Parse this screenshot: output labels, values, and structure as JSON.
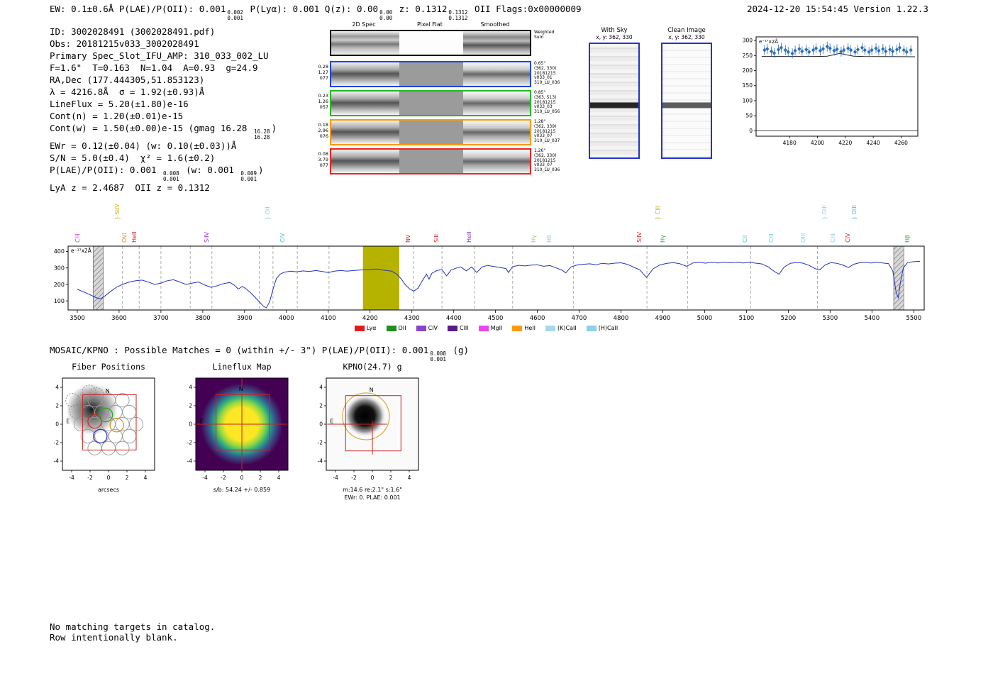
{
  "header": {
    "left_segments": [
      {
        "t": "EW: 0.1±0.6Å  P(LAE)/P(OII): 0.001"
      },
      {
        "s": [
          "0.002",
          "0.001"
        ]
      },
      {
        "t": " P(Lyα): 0.001  Q(z): 0.00"
      },
      {
        "s": [
          "0.00",
          "0.00"
        ]
      },
      {
        "t": " z: 0.1312"
      },
      {
        "s": [
          "0.1312",
          "0.1312"
        ]
      },
      {
        "t": " OII   Flags:0x00000009"
      }
    ],
    "right": "2024-12-20 15:54:45  Version 1.22.3"
  },
  "info_lines": [
    [
      {
        "t": "ID: 3002028491 (3002028491.pdf)"
      }
    ],
    [
      {
        "t": "Obs: 20181215v033_3002028491"
      }
    ],
    [
      {
        "t": "Primary Spec_Slot_IFU_AMP: 310_033_002_LU"
      }
    ],
    [
      {
        "t": "F=1.6\"  T=0.163  N=1.04  A=0.93  g=24.9"
      }
    ],
    [
      {
        "t": "RA,Dec (177.444305,51.853123)"
      }
    ],
    [
      {
        "t": "λ = 4216.8Å  σ = 1.92(±0.93)Å"
      }
    ],
    [
      {
        "t": "LineFlux = 5.20(±1.80)e-16"
      }
    ],
    [
      {
        "t": "Cont(n) = 1.20(±0.01)e-15"
      }
    ],
    [
      {
        "t": "Cont(w) = 1.50(±0.00)e-15 (gmag 16.28 "
      },
      {
        "s": [
          "16.28",
          "16.28"
        ]
      },
      {
        "t": ")"
      }
    ],
    [
      {
        "t": "EWr = 0.12(±0.04) (w: 0.10(±0.03))Å"
      }
    ],
    [
      {
        "t": "S/N = 5.0(±0.4)  χ² = 1.6(±0.2)"
      }
    ],
    [
      {
        "t": "P(LAE)/P(OII): 0.001 "
      },
      {
        "s": [
          "0.008",
          "0.001"
        ]
      },
      {
        "t": " (w: 0.001 "
      },
      {
        "s": [
          "0.009",
          "0.001"
        ]
      },
      {
        "t": ")"
      }
    ],
    [
      {
        "t": "LyA z = 2.4687  OII z = 0.1312"
      }
    ]
  ],
  "cutouts": {
    "col_headers": [
      "2D Spec",
      "Pixel Flat",
      "Smoothed"
    ],
    "sum_label_lines": [
      "Weighted",
      "Sum"
    ],
    "rows": [
      {
        "left": [
          "0.28",
          "1.27",
          "077"
        ],
        "right": [
          "0.65\"",
          "(362, 330)",
          "20181215",
          "v033_01",
          "310_LU_036"
        ],
        "border": "#2244dd"
      },
      {
        "left": [
          "0.23",
          "1.26",
          "057"
        ],
        "right": [
          "0.85\"",
          "(363, 513)",
          "20181215",
          "v033_03",
          "310_LU_056"
        ],
        "border": "#22bb22"
      },
      {
        "left": [
          "0.18",
          "2.96",
          "076"
        ],
        "right": [
          "1.28\"",
          "(362, 339)",
          "20181215",
          "v033_07",
          "310_LU_037"
        ],
        "border": "#ff9900"
      },
      {
        "left": [
          "0.08",
          "3.79",
          "077"
        ],
        "right": [
          "1.26\"",
          "(362, 330)",
          "20181215",
          "v033_07",
          "310_LU_036"
        ],
        "border": "#ee2222"
      }
    ]
  },
  "sky_panels": {
    "with_sky": {
      "title": "With Sky",
      "coords": "x, y: 362, 330"
    },
    "clean": {
      "title": "Clean Image",
      "coords": "x, y: 362, 330"
    }
  },
  "mosaic_segments": [
    {
      "t": "MOSAIC/KPNO : Possible Matches = 0 (within +/- 3\")  P(LAE)/P(OII): 0.001"
    },
    {
      "s": [
        "0.008",
        "0.001"
      ]
    },
    {
      "t": " (g)"
    }
  ],
  "matches_panels": {
    "fiber": {
      "title": "Fiber Positions",
      "xlabel": "arcsecs"
    },
    "lineflux": {
      "title": "Lineflux Map",
      "caption": "s/b: 54.24 +/- 0.859"
    },
    "kpno": {
      "title": "KPNO(24.7) g",
      "caption1": "m:14.6 re:2.1\" s:1.6\"",
      "caption2": "EWr: 0. PLAE: 0.001"
    },
    "ticks": [
      -4,
      -2,
      0,
      2,
      4
    ],
    "north_label": "N",
    "east_label": "E"
  },
  "footer_lines": [
    "No matching targets in catalog.",
    "Row intentionally blank."
  ],
  "chart_data": [
    {
      "type": "scatter",
      "note": "e⁻¹⁷x2Å",
      "xticks": [
        4180,
        4200,
        4220,
        4240,
        4260
      ],
      "yticks": [
        0,
        50,
        100,
        150,
        200,
        250,
        300
      ],
      "xlim": [
        4156,
        4272
      ],
      "ylim": [
        -18,
        312
      ],
      "point_color": "#2a6fba",
      "line_color": "#222222",
      "points": [
        [
          4162,
          268
        ],
        [
          4164,
          272
        ],
        [
          4167,
          264
        ],
        [
          4169,
          258
        ],
        [
          4172,
          270
        ],
        [
          4174,
          276
        ],
        [
          4177,
          268
        ],
        [
          4179,
          262
        ],
        [
          4182,
          257
        ],
        [
          4184,
          266
        ],
        [
          4187,
          272
        ],
        [
          4189,
          264
        ],
        [
          4192,
          270
        ],
        [
          4194,
          262
        ],
        [
          4197,
          268
        ],
        [
          4199,
          274
        ],
        [
          4202,
          266
        ],
        [
          4204,
          272
        ],
        [
          4207,
          280
        ],
        [
          4209,
          274
        ],
        [
          4212,
          266
        ],
        [
          4214,
          271
        ],
        [
          4217,
          263
        ],
        [
          4219,
          268
        ],
        [
          4222,
          274
        ],
        [
          4224,
          268
        ],
        [
          4227,
          262
        ],
        [
          4229,
          270
        ],
        [
          4232,
          276
        ],
        [
          4234,
          268
        ],
        [
          4237,
          262
        ],
        [
          4239,
          268
        ],
        [
          4242,
          274
        ],
        [
          4244,
          266
        ],
        [
          4247,
          272
        ],
        [
          4249,
          264
        ],
        [
          4252,
          270
        ],
        [
          4254,
          264
        ],
        [
          4257,
          270
        ],
        [
          4259,
          276
        ],
        [
          4262,
          268
        ],
        [
          4264,
          262
        ],
        [
          4267,
          268
        ]
      ],
      "fit_line": [
        [
          4160,
          247
        ],
        [
          4200,
          247
        ],
        [
          4207,
          248
        ],
        [
          4212,
          253
        ],
        [
          4216,
          257
        ],
        [
          4220,
          253
        ],
        [
          4226,
          248
        ],
        [
          4233,
          247
        ],
        [
          4270,
          246
        ]
      ]
    },
    {
      "type": "line",
      "note": "e⁻¹⁷x2Å",
      "xticks": [
        3500,
        3600,
        3700,
        3800,
        3900,
        4000,
        4100,
        4200,
        4300,
        4400,
        4500,
        4600,
        4700,
        4800,
        4900,
        5000,
        5100,
        5200,
        5300,
        5400,
        5500
      ],
      "yticks": [
        100,
        200,
        300,
        400
      ],
      "xlim": [
        3478,
        5525
      ],
      "ylim": [
        45,
        432
      ],
      "series_color": "#2233bb",
      "highlight_band": {
        "range": [
          4183,
          4270
        ],
        "color": "#b5b300"
      },
      "hatch_bands": [
        [
          3538,
          3562
        ],
        [
          5452,
          5476
        ]
      ],
      "dashed_lines": [
        3608,
        3648,
        3700,
        3770,
        3822,
        3935,
        3968,
        4026,
        4102,
        4304,
        4372,
        4450,
        4541,
        4686,
        4862,
        4959,
        5110,
        5270
      ],
      "line_labels": [
        {
          "text": "CIII",
          "wave": 3513,
          "color": "#cc44cc",
          "tall": false
        },
        {
          "text": "SiIV",
          "wave": 3608,
          "color": "#d4aa00",
          "tall": true
        },
        {
          "text": "OVI",
          "wave": 3626,
          "color": "#ee8822",
          "tall": false
        },
        {
          "text": "HeII",
          "wave": 3650,
          "color": "#cc2222",
          "tall": false
        },
        {
          "text": "SiIV",
          "wave": 3822,
          "color": "#8833cc",
          "tall": false
        },
        {
          "text": "OII",
          "wave": 3968,
          "color": "#77ccee",
          "tall": true
        },
        {
          "text": "CIV",
          "wave": 4004,
          "color": "#44bbcc",
          "tall": false
        },
        {
          "text": "NV",
          "wave": 4304,
          "color": "#cc2222",
          "tall": false
        },
        {
          "text": "SiII",
          "wave": 4372,
          "color": "#cc2222",
          "tall": false
        },
        {
          "text": "HeII",
          "wave": 4450,
          "color": "#8833cc",
          "tall": false
        },
        {
          "text": "Hγ",
          "wave": 4604,
          "color": "#99cc66",
          "tall": false
        },
        {
          "text": "Hδ",
          "wave": 4642,
          "color": "#88ccdd",
          "tall": false
        },
        {
          "text": "SiIV",
          "wave": 4856,
          "color": "#cc2222",
          "tall": false
        },
        {
          "text": "CIII",
          "wave": 4900,
          "color": "#d4aa00",
          "tall": true
        },
        {
          "text": "Hγ",
          "wave": 4912,
          "color": "#33aa33",
          "tall": false
        },
        {
          "text": "CII",
          "wave": 5110,
          "color": "#44bbcc",
          "tall": false
        },
        {
          "text": "CIII",
          "wave": 5172,
          "color": "#66ccee",
          "tall": false
        },
        {
          "text": "OIII",
          "wave": 5248,
          "color": "#88ccee",
          "tall": false
        },
        {
          "text": "OIII",
          "wave": 5300,
          "color": "#88ccee",
          "tall": true
        },
        {
          "text": "CIII",
          "wave": 5320,
          "color": "#88ccee",
          "tall": false
        },
        {
          "text": "CIV",
          "wave": 5356,
          "color": "#cc2222",
          "tall": false
        },
        {
          "text": "OIII",
          "wave": 5370,
          "color": "#44bbcc",
          "tall": true
        },
        {
          "text": "Hβ",
          "wave": 5497,
          "color": "#33aa33",
          "tall": false
        }
      ],
      "legend": [
        {
          "label": "Lyα",
          "color": "#e41a1c"
        },
        {
          "label": "OII",
          "color": "#1f8f1f"
        },
        {
          "label": "CIV",
          "color": "#8844cc"
        },
        {
          "label": "CIII",
          "color": "#5a1a8a"
        },
        {
          "label": "MgII",
          "color": "#ee44ee"
        },
        {
          "label": "HeII",
          "color": "#ff9911"
        },
        {
          "label": "(K)CaII",
          "color": "#a8d8ea"
        },
        {
          "label": "(H)CaII",
          "color": "#8fd0e8"
        }
      ],
      "points": [
        [
          3500,
          170
        ],
        [
          3515,
          155
        ],
        [
          3530,
          138
        ],
        [
          3545,
          120
        ],
        [
          3555,
          112
        ],
        [
          3565,
          128
        ],
        [
          3580,
          158
        ],
        [
          3595,
          185
        ],
        [
          3610,
          202
        ],
        [
          3625,
          215
        ],
        [
          3640,
          222
        ],
        [
          3655,
          226
        ],
        [
          3670,
          214
        ],
        [
          3685,
          200
        ],
        [
          3700,
          208
        ],
        [
          3715,
          222
        ],
        [
          3730,
          228
        ],
        [
          3745,
          215
        ],
        [
          3760,
          200
        ],
        [
          3775,
          208
        ],
        [
          3790,
          215
        ],
        [
          3805,
          196
        ],
        [
          3820,
          182
        ],
        [
          3835,
          192
        ],
        [
          3850,
          205
        ],
        [
          3865,
          212
        ],
        [
          3875,
          196
        ],
        [
          3885,
          172
        ],
        [
          3895,
          188
        ],
        [
          3905,
          170
        ],
        [
          3915,
          148
        ],
        [
          3925,
          122
        ],
        [
          3935,
          95
        ],
        [
          3945,
          68
        ],
        [
          3952,
          58
        ],
        [
          3960,
          95
        ],
        [
          3968,
          170
        ],
        [
          3976,
          235
        ],
        [
          3985,
          262
        ],
        [
          3995,
          274
        ],
        [
          4010,
          280
        ],
        [
          4025,
          276
        ],
        [
          4040,
          282
        ],
        [
          4055,
          278
        ],
        [
          4070,
          284
        ],
        [
          4085,
          279
        ],
        [
          4100,
          272
        ],
        [
          4115,
          280
        ],
        [
          4130,
          285
        ],
        [
          4145,
          280
        ],
        [
          4160,
          284
        ],
        [
          4175,
          287
        ],
        [
          4190,
          289
        ],
        [
          4205,
          291
        ],
        [
          4216,
          294
        ],
        [
          4228,
          288
        ],
        [
          4240,
          284
        ],
        [
          4252,
          280
        ],
        [
          4264,
          262
        ],
        [
          4275,
          232
        ],
        [
          4285,
          196
        ],
        [
          4295,
          172
        ],
        [
          4305,
          160
        ],
        [
          4315,
          178
        ],
        [
          4325,
          222
        ],
        [
          4335,
          262
        ],
        [
          4341,
          232
        ],
        [
          4348,
          268
        ],
        [
          4360,
          284
        ],
        [
          4372,
          290
        ],
        [
          4383,
          252
        ],
        [
          4394,
          288
        ],
        [
          4405,
          298
        ],
        [
          4417,
          306
        ],
        [
          4430,
          282
        ],
        [
          4443,
          306
        ],
        [
          4455,
          272
        ],
        [
          4468,
          306
        ],
        [
          4481,
          315
        ],
        [
          4495,
          309
        ],
        [
          4510,
          303
        ],
        [
          4525,
          296
        ],
        [
          4531,
          272
        ],
        [
          4540,
          306
        ],
        [
          4555,
          316
        ],
        [
          4570,
          312
        ],
        [
          4585,
          317
        ],
        [
          4600,
          319
        ],
        [
          4615,
          310
        ],
        [
          4630,
          314
        ],
        [
          4645,
          300
        ],
        [
          4658,
          288
        ],
        [
          4668,
          270
        ],
        [
          4680,
          305
        ],
        [
          4695,
          318
        ],
        [
          4710,
          322
        ],
        [
          4725,
          325
        ],
        [
          4740,
          319
        ],
        [
          4755,
          328
        ],
        [
          4770,
          324
        ],
        [
          4785,
          329
        ],
        [
          4800,
          331
        ],
        [
          4815,
          322
        ],
        [
          4830,
          305
        ],
        [
          4845,
          288
        ],
        [
          4861,
          242
        ],
        [
          4877,
          295
        ],
        [
          4893,
          318
        ],
        [
          4910,
          328
        ],
        [
          4925,
          332
        ],
        [
          4940,
          326
        ],
        [
          4957,
          310
        ],
        [
          4972,
          330
        ],
        [
          4987,
          334
        ],
        [
          5002,
          329
        ],
        [
          5017,
          334
        ],
        [
          5032,
          330
        ],
        [
          5047,
          335
        ],
        [
          5062,
          331
        ],
        [
          5077,
          335
        ],
        [
          5092,
          330
        ],
        [
          5107,
          334
        ],
        [
          5122,
          329
        ],
        [
          5137,
          324
        ],
        [
          5152,
          306
        ],
        [
          5167,
          278
        ],
        [
          5178,
          262
        ],
        [
          5190,
          305
        ],
        [
          5205,
          328
        ],
        [
          5220,
          333
        ],
        [
          5235,
          329
        ],
        [
          5250,
          315
        ],
        [
          5265,
          295
        ],
        [
          5275,
          288
        ],
        [
          5288,
          318
        ],
        [
          5302,
          332
        ],
        [
          5316,
          328
        ],
        [
          5330,
          318
        ],
        [
          5344,
          302
        ],
        [
          5356,
          322
        ],
        [
          5370,
          331
        ],
        [
          5384,
          334
        ],
        [
          5398,
          330
        ],
        [
          5412,
          334
        ],
        [
          5426,
          330
        ],
        [
          5440,
          326
        ],
        [
          5450,
          280
        ],
        [
          5458,
          150
        ],
        [
          5463,
          120
        ],
        [
          5468,
          210
        ],
        [
          5475,
          300
        ],
        [
          5485,
          332
        ],
        [
          5500,
          338
        ],
        [
          5515,
          340
        ]
      ]
    }
  ]
}
